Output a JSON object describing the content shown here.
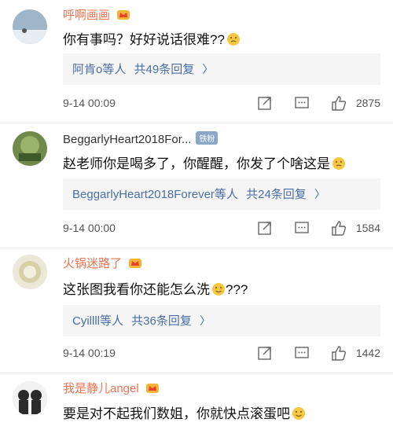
{
  "comments": [
    {
      "username": "呼啊画画",
      "text": "你有事吗？好好说话很难??",
      "replies_users": "阿肯o等人",
      "replies_count": "共49条回复",
      "time": "9-14 00:09",
      "likes": "2875",
      "name_color": "#eb7350"
    },
    {
      "username": "BeggarlyHeart2018For...",
      "fan_badge": "铁粉",
      "text": "赵老师你是喝多了，你醒醒，你发了个啥这是",
      "replies_users": "BeggarlyHeart2018Forever等人",
      "replies_count": "共24条回复",
      "time": "9-14 00:00",
      "likes": "1584",
      "name_color": "#333333"
    },
    {
      "username": "火锅迷路了",
      "text": "这张图我看你还能怎么洗",
      "text_suffix": "???",
      "replies_users": "Cyillll等人",
      "replies_count": "共36条回复",
      "time": "9-14 00:19",
      "likes": "1442",
      "name_color": "#eb7350"
    },
    {
      "username": "我是静儿angel",
      "text": "要是对不起我们数姐，你就快点滚蛋吧",
      "name_color": "#eb7350"
    }
  ]
}
